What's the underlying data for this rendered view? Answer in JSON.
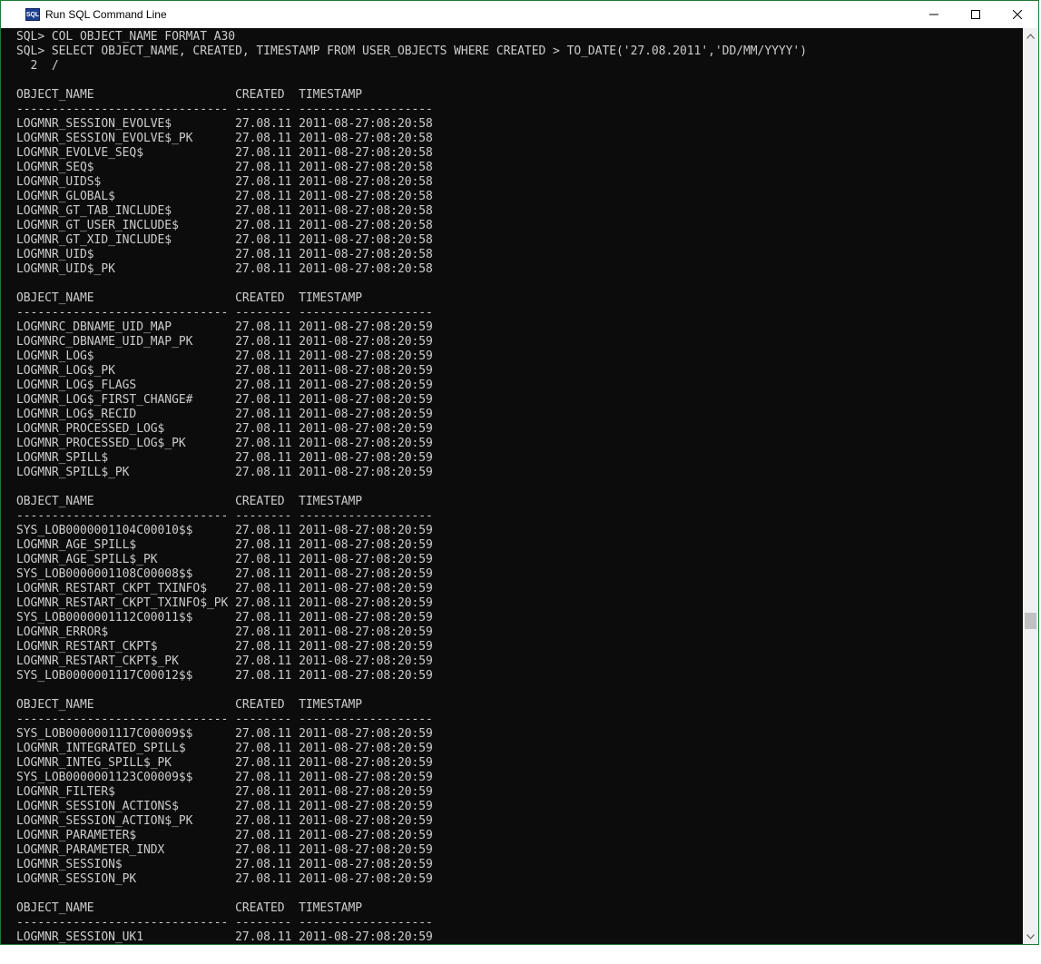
{
  "window": {
    "title": "Run SQL Command Line",
    "icon_text": "SQL"
  },
  "controls": {
    "minimize_icon": "minimize-icon",
    "maximize_icon": "maximize-icon",
    "close_icon": "close-icon"
  },
  "console": {
    "lines": [
      "SQL> COL OBJECT_NAME FORMAT A30",
      "SQL> SELECT OBJECT_NAME, CREATED, TIMESTAMP FROM USER_OBJECTS WHERE CREATED > TO_DATE('27.08.2011','DD/MM/YYYY')",
      "  2  /",
      "",
      "OBJECT_NAME                    CREATED  TIMESTAMP",
      "------------------------------ -------- -------------------",
      "LOGMNR_SESSION_EVOLVE$         27.08.11 2011-08-27:08:20:58",
      "LOGMNR_SESSION_EVOLVE$_PK      27.08.11 2011-08-27:08:20:58",
      "LOGMNR_EVOLVE_SEQ$             27.08.11 2011-08-27:08:20:58",
      "LOGMNR_SEQ$                    27.08.11 2011-08-27:08:20:58",
      "LOGMNR_UIDS$                   27.08.11 2011-08-27:08:20:58",
      "LOGMNR_GLOBAL$                 27.08.11 2011-08-27:08:20:58",
      "LOGMNR_GT_TAB_INCLUDE$         27.08.11 2011-08-27:08:20:58",
      "LOGMNR_GT_USER_INCLUDE$        27.08.11 2011-08-27:08:20:58",
      "LOGMNR_GT_XID_INCLUDE$         27.08.11 2011-08-27:08:20:58",
      "LOGMNR_UID$                    27.08.11 2011-08-27:08:20:58",
      "LOGMNR_UID$_PK                 27.08.11 2011-08-27:08:20:58",
      "",
      "OBJECT_NAME                    CREATED  TIMESTAMP",
      "------------------------------ -------- -------------------",
      "LOGMNRC_DBNAME_UID_MAP         27.08.11 2011-08-27:08:20:59",
      "LOGMNRC_DBNAME_UID_MAP_PK      27.08.11 2011-08-27:08:20:59",
      "LOGMNR_LOG$                    27.08.11 2011-08-27:08:20:59",
      "LOGMNR_LOG$_PK                 27.08.11 2011-08-27:08:20:59",
      "LOGMNR_LOG$_FLAGS              27.08.11 2011-08-27:08:20:59",
      "LOGMNR_LOG$_FIRST_CHANGE#      27.08.11 2011-08-27:08:20:59",
      "LOGMNR_LOG$_RECID              27.08.11 2011-08-27:08:20:59",
      "LOGMNR_PROCESSED_LOG$          27.08.11 2011-08-27:08:20:59",
      "LOGMNR_PROCESSED_LOG$_PK       27.08.11 2011-08-27:08:20:59",
      "LOGMNR_SPILL$                  27.08.11 2011-08-27:08:20:59",
      "LOGMNR_SPILL$_PK               27.08.11 2011-08-27:08:20:59",
      "",
      "OBJECT_NAME                    CREATED  TIMESTAMP",
      "------------------------------ -------- -------------------",
      "SYS_LOB0000001104C00010$$      27.08.11 2011-08-27:08:20:59",
      "LOGMNR_AGE_SPILL$              27.08.11 2011-08-27:08:20:59",
      "LOGMNR_AGE_SPILL$_PK           27.08.11 2011-08-27:08:20:59",
      "SYS_LOB0000001108C00008$$      27.08.11 2011-08-27:08:20:59",
      "LOGMNR_RESTART_CKPT_TXINFO$    27.08.11 2011-08-27:08:20:59",
      "LOGMNR_RESTART_CKPT_TXINFO$_PK 27.08.11 2011-08-27:08:20:59",
      "SYS_LOB0000001112C00011$$      27.08.11 2011-08-27:08:20:59",
      "LOGMNR_ERROR$                  27.08.11 2011-08-27:08:20:59",
      "LOGMNR_RESTART_CKPT$           27.08.11 2011-08-27:08:20:59",
      "LOGMNR_RESTART_CKPT$_PK        27.08.11 2011-08-27:08:20:59",
      "SYS_LOB0000001117C00012$$      27.08.11 2011-08-27:08:20:59",
      "",
      "OBJECT_NAME                    CREATED  TIMESTAMP",
      "------------------------------ -------- -------------------",
      "SYS_LOB0000001117C00009$$      27.08.11 2011-08-27:08:20:59",
      "LOGMNR_INTEGRATED_SPILL$       27.08.11 2011-08-27:08:20:59",
      "LOGMNR_INTEG_SPILL$_PK         27.08.11 2011-08-27:08:20:59",
      "SYS_LOB0000001123C00009$$      27.08.11 2011-08-27:08:20:59",
      "LOGMNR_FILTER$                 27.08.11 2011-08-27:08:20:59",
      "LOGMNR_SESSION_ACTIONS$        27.08.11 2011-08-27:08:20:59",
      "LOGMNR_SESSION_ACTION$_PK      27.08.11 2011-08-27:08:20:59",
      "LOGMNR_PARAMETER$              27.08.11 2011-08-27:08:20:59",
      "LOGMNR_PARAMETER_INDX          27.08.11 2011-08-27:08:20:59",
      "LOGMNR_SESSION$                27.08.11 2011-08-27:08:20:59",
      "LOGMNR_SESSION_PK              27.08.11 2011-08-27:08:20:59",
      "",
      "OBJECT_NAME                    CREATED  TIMESTAMP",
      "------------------------------ -------- -------------------",
      "LOGMNR_SESSION_UK1             27.08.11 2011-08-27:08:20:59"
    ]
  },
  "scrollbar": {
    "up_icon": "scroll-up-arrow-icon",
    "down_icon": "scroll-down-arrow-icon"
  },
  "colors": {
    "console_bg": "#0c0c0c",
    "console_fg": "#cccccc",
    "window_border": "#1e7a2e"
  }
}
